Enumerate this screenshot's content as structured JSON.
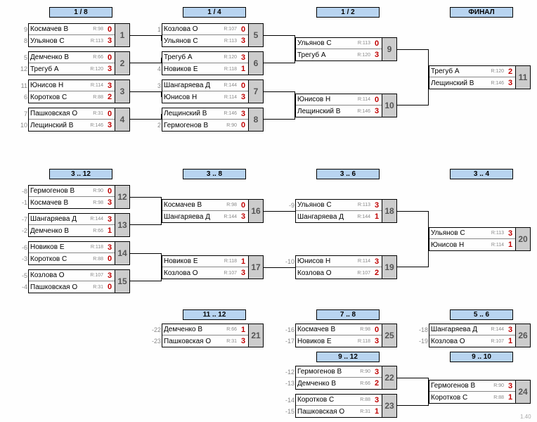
{
  "version": "1.40",
  "rounds": {
    "r18": "1 / 8",
    "r14": "1 / 4",
    "r12": "1 / 2",
    "final": "ФИНАЛ",
    "r3_12": "3 .. 12",
    "r3_8": "3 .. 8",
    "r3_6": "3 .. 6",
    "r3_4": "3 .. 4",
    "r11_12": "11 .. 12",
    "r7_8": "7 .. 8",
    "r5_6": "5 .. 6",
    "r9_12": "9 .. 12",
    "r9_10": "9 .. 10"
  },
  "matches": {
    "m1": {
      "num": "1",
      "p1": {
        "seed": "9",
        "name": "Космачев В",
        "rating": "R:98",
        "score": "0"
      },
      "p2": {
        "seed": "8",
        "name": "Ульянов С",
        "rating": "R:113",
        "score": "3"
      }
    },
    "m2": {
      "num": "2",
      "p1": {
        "seed": "5",
        "name": "Демченко В",
        "rating": "R:66",
        "score": "0"
      },
      "p2": {
        "seed": "12",
        "name": "Трегуб А",
        "rating": "R:120",
        "score": "3"
      }
    },
    "m3": {
      "num": "3",
      "p1": {
        "seed": "11",
        "name": "Юнисов Н",
        "rating": "R:114",
        "score": "3"
      },
      "p2": {
        "seed": "6",
        "name": "Коротков С",
        "rating": "R:88",
        "score": "2"
      }
    },
    "m4": {
      "num": "4",
      "p1": {
        "seed": "7",
        "name": "Пашковская О",
        "rating": "R:31",
        "score": "0"
      },
      "p2": {
        "seed": "10",
        "name": "Лещинский В",
        "rating": "R:146",
        "score": "3"
      }
    },
    "m5": {
      "num": "5",
      "p1": {
        "seed": "1",
        "name": "Козлова О",
        "rating": "R:107",
        "score": "0"
      },
      "p2": {
        "seed": "",
        "name": "Ульянов С",
        "rating": "R:113",
        "score": "3"
      }
    },
    "m6": {
      "num": "6",
      "p1": {
        "seed": "",
        "name": "Трегуб А",
        "rating": "R:120",
        "score": "3"
      },
      "p2": {
        "seed": "4",
        "name": "Новиков Е",
        "rating": "R:118",
        "score": "1"
      }
    },
    "m7": {
      "num": "7",
      "p1": {
        "seed": "3",
        "name": "Шангаряева Д",
        "rating": "R:144",
        "score": "0"
      },
      "p2": {
        "seed": "",
        "name": "Юнисов Н",
        "rating": "R:114",
        "score": "3"
      }
    },
    "m8": {
      "num": "8",
      "p1": {
        "seed": "",
        "name": "Лещинский В",
        "rating": "R:146",
        "score": "3"
      },
      "p2": {
        "seed": "2",
        "name": "Гермогенов В",
        "rating": "R:90",
        "score": "0"
      }
    },
    "m9": {
      "num": "9",
      "p1": {
        "seed": "",
        "name": "Ульянов С",
        "rating": "R:113",
        "score": "0"
      },
      "p2": {
        "seed": "",
        "name": "Трегуб А",
        "rating": "R:120",
        "score": "3"
      }
    },
    "m10": {
      "num": "10",
      "p1": {
        "seed": "",
        "name": "Юнисов Н",
        "rating": "R:114",
        "score": "0"
      },
      "p2": {
        "seed": "",
        "name": "Лещинский В",
        "rating": "R:146",
        "score": "3"
      }
    },
    "m11": {
      "num": "11",
      "p1": {
        "seed": "",
        "name": "Трегуб А",
        "rating": "R:120",
        "score": "2"
      },
      "p2": {
        "seed": "",
        "name": "Лещинский В",
        "rating": "R:146",
        "score": "3"
      }
    },
    "m12": {
      "num": "12",
      "p1": {
        "seed": "-8",
        "name": "Гермогенов В",
        "rating": "R:90",
        "score": "0"
      },
      "p2": {
        "seed": "-1",
        "name": "Космачев В",
        "rating": "R:98",
        "score": "3"
      }
    },
    "m13": {
      "num": "13",
      "p1": {
        "seed": "-7",
        "name": "Шангаряева Д",
        "rating": "R:144",
        "score": "3"
      },
      "p2": {
        "seed": "-2",
        "name": "Демченко В",
        "rating": "R:66",
        "score": "1"
      }
    },
    "m14": {
      "num": "14",
      "p1": {
        "seed": "-6",
        "name": "Новиков Е",
        "rating": "R:118",
        "score": "3"
      },
      "p2": {
        "seed": "-3",
        "name": "Коротков С",
        "rating": "R:88",
        "score": "0"
      }
    },
    "m15": {
      "num": "15",
      "p1": {
        "seed": "-5",
        "name": "Козлова О",
        "rating": "R:107",
        "score": "3"
      },
      "p2": {
        "seed": "-4",
        "name": "Пашковская О",
        "rating": "R:31",
        "score": "0"
      }
    },
    "m16": {
      "num": "16",
      "p1": {
        "seed": "",
        "name": "Космачев В",
        "rating": "R:98",
        "score": "0"
      },
      "p2": {
        "seed": "",
        "name": "Шангаряева Д",
        "rating": "R:144",
        "score": "3"
      }
    },
    "m17": {
      "num": "17",
      "p1": {
        "seed": "",
        "name": "Новиков Е",
        "rating": "R:118",
        "score": "1"
      },
      "p2": {
        "seed": "",
        "name": "Козлова О",
        "rating": "R:107",
        "score": "3"
      }
    },
    "m18": {
      "num": "18",
      "p1": {
        "seed": "-9",
        "name": "Ульянов С",
        "rating": "R:113",
        "score": "3"
      },
      "p2": {
        "seed": "",
        "name": "Шангаряева Д",
        "rating": "R:144",
        "score": "1"
      }
    },
    "m19": {
      "num": "19",
      "p1": {
        "seed": "-10",
        "name": "Юнисов Н",
        "rating": "R:114",
        "score": "3"
      },
      "p2": {
        "seed": "",
        "name": "Козлова О",
        "rating": "R:107",
        "score": "2"
      }
    },
    "m20": {
      "num": "20",
      "p1": {
        "seed": "",
        "name": "Ульянов С",
        "rating": "R:113",
        "score": "3"
      },
      "p2": {
        "seed": "",
        "name": "Юнисов Н",
        "rating": "R:114",
        "score": "1"
      }
    },
    "m21": {
      "num": "21",
      "p1": {
        "seed": "-22",
        "name": "Демченко В",
        "rating": "R:66",
        "score": "1"
      },
      "p2": {
        "seed": "-23",
        "name": "Пашковская О",
        "rating": "R:31",
        "score": "3"
      }
    },
    "m22": {
      "num": "22",
      "p1": {
        "seed": "-12",
        "name": "Гермогенов В",
        "rating": "R:90",
        "score": "3"
      },
      "p2": {
        "seed": "-13",
        "name": "Демченко В",
        "rating": "R:66",
        "score": "2"
      }
    },
    "m23": {
      "num": "23",
      "p1": {
        "seed": "-14",
        "name": "Коротков С",
        "rating": "R:88",
        "score": "3"
      },
      "p2": {
        "seed": "-15",
        "name": "Пашковская О",
        "rating": "R:31",
        "score": "1"
      }
    },
    "m24": {
      "num": "24",
      "p1": {
        "seed": "",
        "name": "Гермогенов В",
        "rating": "R:90",
        "score": "3"
      },
      "p2": {
        "seed": "",
        "name": "Коротков С",
        "rating": "R:88",
        "score": "1"
      }
    },
    "m25": {
      "num": "25",
      "p1": {
        "seed": "-16",
        "name": "Космачев В",
        "rating": "R:98",
        "score": "0"
      },
      "p2": {
        "seed": "-17",
        "name": "Новиков Е",
        "rating": "R:118",
        "score": "3"
      }
    },
    "m26": {
      "num": "26",
      "p1": {
        "seed": "-18",
        "name": "Шангаряева Д",
        "rating": "R:144",
        "score": "3"
      },
      "p2": {
        "seed": "-19",
        "name": "Козлова О",
        "rating": "R:107",
        "score": "1"
      }
    }
  }
}
